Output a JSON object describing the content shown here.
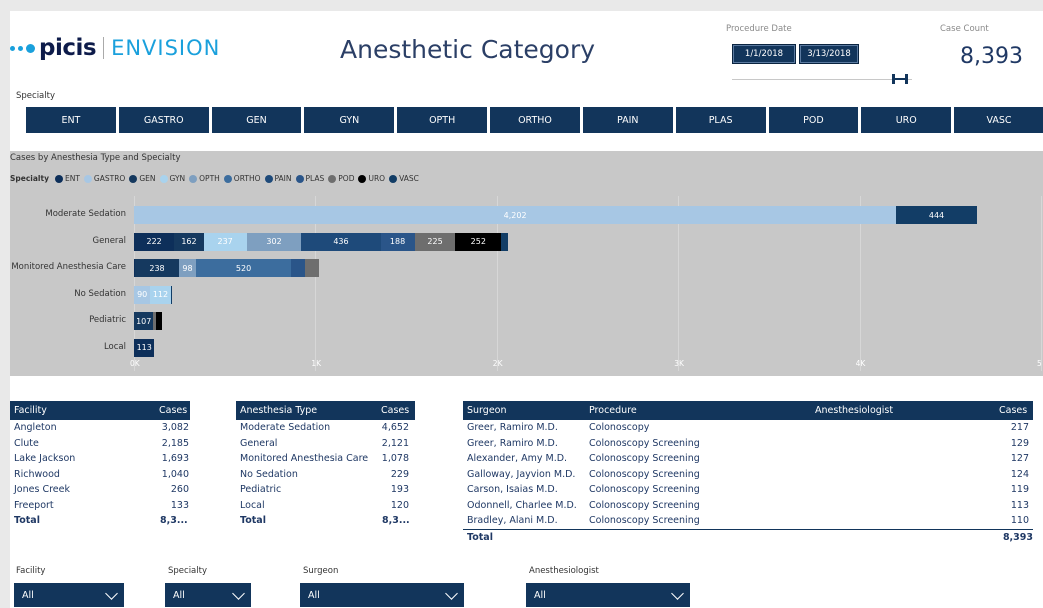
{
  "header": {
    "brand": "picis",
    "product": "ENVISION",
    "title": "Anesthetic Category",
    "procedure_date_label": "Procedure Date",
    "date_start": "1/1/2018",
    "date_end": "3/13/2018",
    "case_count_label": "Case Count",
    "case_count": "8,393"
  },
  "specialty": {
    "label": "Specialty",
    "tiles": [
      "ENT",
      "GASTRO",
      "GEN",
      "GYN",
      "OPTH",
      "ORTHO",
      "PAIN",
      "PLAS",
      "POD",
      "URO",
      "VASC"
    ]
  },
  "colors": {
    "navy": "#12355b",
    "ENT": "#0d2f5a",
    "GASTRO": "#a7c7e4",
    "GEN": "#15395f",
    "GYN": "#a9d3ee",
    "OPTH": "#7e9fc0",
    "ORTHO": "#3c6d9e",
    "PAIN": "#1e4a7a",
    "PLAS": "#2a5589",
    "POD": "#6e6e6e",
    "URO": "#000000",
    "VASC": "#123d66"
  },
  "chart_data": {
    "type": "bar",
    "orientation": "horizontal-stacked",
    "title": "Cases by Anesthesia Type and Specialty",
    "legend_title": "Specialty",
    "legend": [
      "ENT",
      "GASTRO",
      "GEN",
      "GYN",
      "OPTH",
      "ORTHO",
      "PAIN",
      "PLAS",
      "POD",
      "URO",
      "VASC"
    ],
    "categories": [
      "Moderate Sedation",
      "General",
      "Monitored Anesthesia Care",
      "No Sedation",
      "Pediatric",
      "Local"
    ],
    "xlim": [
      0,
      5000
    ],
    "xticks": [
      "0K",
      "1K",
      "2K",
      "3K",
      "4K",
      "5"
    ],
    "series": [
      {
        "name": "ENT",
        "values": [
          0,
          222,
          8,
          0,
          0,
          113
        ]
      },
      {
        "name": "GASTRO",
        "values": [
          4202,
          0,
          0,
          90,
          0,
          0
        ]
      },
      {
        "name": "GEN",
        "values": [
          0,
          162,
          238,
          0,
          107,
          0
        ]
      },
      {
        "name": "GYN",
        "values": [
          0,
          237,
          0,
          112,
          0,
          0
        ]
      },
      {
        "name": "OPTH",
        "values": [
          0,
          302,
          98,
          0,
          0,
          0
        ]
      },
      {
        "name": "ORTHO",
        "values": [
          0,
          0,
          520,
          0,
          0,
          0
        ]
      },
      {
        "name": "PAIN",
        "values": [
          0,
          436,
          0,
          0,
          0,
          0
        ]
      },
      {
        "name": "PLAS",
        "values": [
          0,
          188,
          77,
          0,
          0,
          0
        ]
      },
      {
        "name": "POD",
        "values": [
          0,
          225,
          80,
          0,
          15,
          0
        ]
      },
      {
        "name": "URO",
        "values": [
          0,
          252,
          0,
          0,
          30,
          0
        ]
      },
      {
        "name": "VASC",
        "values": [
          444,
          40,
          0,
          10,
          0,
          0
        ]
      }
    ]
  },
  "facility_table": {
    "headers": [
      "Facility",
      "Cases"
    ],
    "rows": [
      {
        "name": "Angleton",
        "cases": "3,082",
        "v": 3082
      },
      {
        "name": "Clute",
        "cases": "2,185",
        "v": 2185
      },
      {
        "name": "Lake Jackson",
        "cases": "1,693",
        "v": 1693
      },
      {
        "name": "Richwood",
        "cases": "1,040",
        "v": 1040
      },
      {
        "name": "Jones Creek",
        "cases": "260",
        "v": 260
      },
      {
        "name": "Freeport",
        "cases": "133",
        "v": 133
      }
    ],
    "total_label": "Total",
    "total": "8,3..."
  },
  "anesthesia_table": {
    "headers": [
      "Anesthesia Type",
      "Cases"
    ],
    "rows": [
      {
        "name": "Moderate Sedation",
        "cases": "4,652",
        "v": 4652
      },
      {
        "name": "General",
        "cases": "2,121",
        "v": 2121
      },
      {
        "name": "Monitored Anesthesia Care",
        "cases": "1,078",
        "v": 1078
      },
      {
        "name": "No Sedation",
        "cases": "229",
        "v": 229
      },
      {
        "name": "Pediatric",
        "cases": "193",
        "v": 193
      },
      {
        "name": "Local",
        "cases": "120",
        "v": 120
      }
    ],
    "total_label": "Total",
    "total": "8,3..."
  },
  "surgeon_table": {
    "headers": [
      "Surgeon",
      "Procedure",
      "Anesthesiologist",
      "Cases"
    ],
    "rows": [
      {
        "surgeon": "Greer, Ramiro M.D.",
        "procedure": "Colonoscopy",
        "anesthesiologist": "",
        "cases": "217",
        "v": 217
      },
      {
        "surgeon": "Greer, Ramiro M.D.",
        "procedure": "Colonoscopy Screening",
        "anesthesiologist": "",
        "cases": "129",
        "v": 129
      },
      {
        "surgeon": "Alexander, Amy M.D.",
        "procedure": "Colonoscopy Screening",
        "anesthesiologist": "",
        "cases": "127",
        "v": 127
      },
      {
        "surgeon": "Galloway, Jayvion M.D.",
        "procedure": "Colonoscopy Screening",
        "anesthesiologist": "",
        "cases": "124",
        "v": 124
      },
      {
        "surgeon": "Carson, Isaias M.D.",
        "procedure": "Colonoscopy Screening",
        "anesthesiologist": "",
        "cases": "119",
        "v": 119
      },
      {
        "surgeon": "Odonnell, Charlee M.D.",
        "procedure": "Colonoscopy Screening",
        "anesthesiologist": "",
        "cases": "113",
        "v": 113
      },
      {
        "surgeon": "Bradley, Alani M.D.",
        "procedure": "Colonoscopy Screening",
        "anesthesiologist": "",
        "cases": "110",
        "v": 110
      }
    ],
    "total_label": "Total",
    "total": "8,393"
  },
  "slicers": [
    {
      "label": "Facility",
      "value": "All"
    },
    {
      "label": "Specialty",
      "value": "All"
    },
    {
      "label": "Surgeon",
      "value": "All"
    },
    {
      "label": "Anesthesiologist",
      "value": "All"
    }
  ]
}
